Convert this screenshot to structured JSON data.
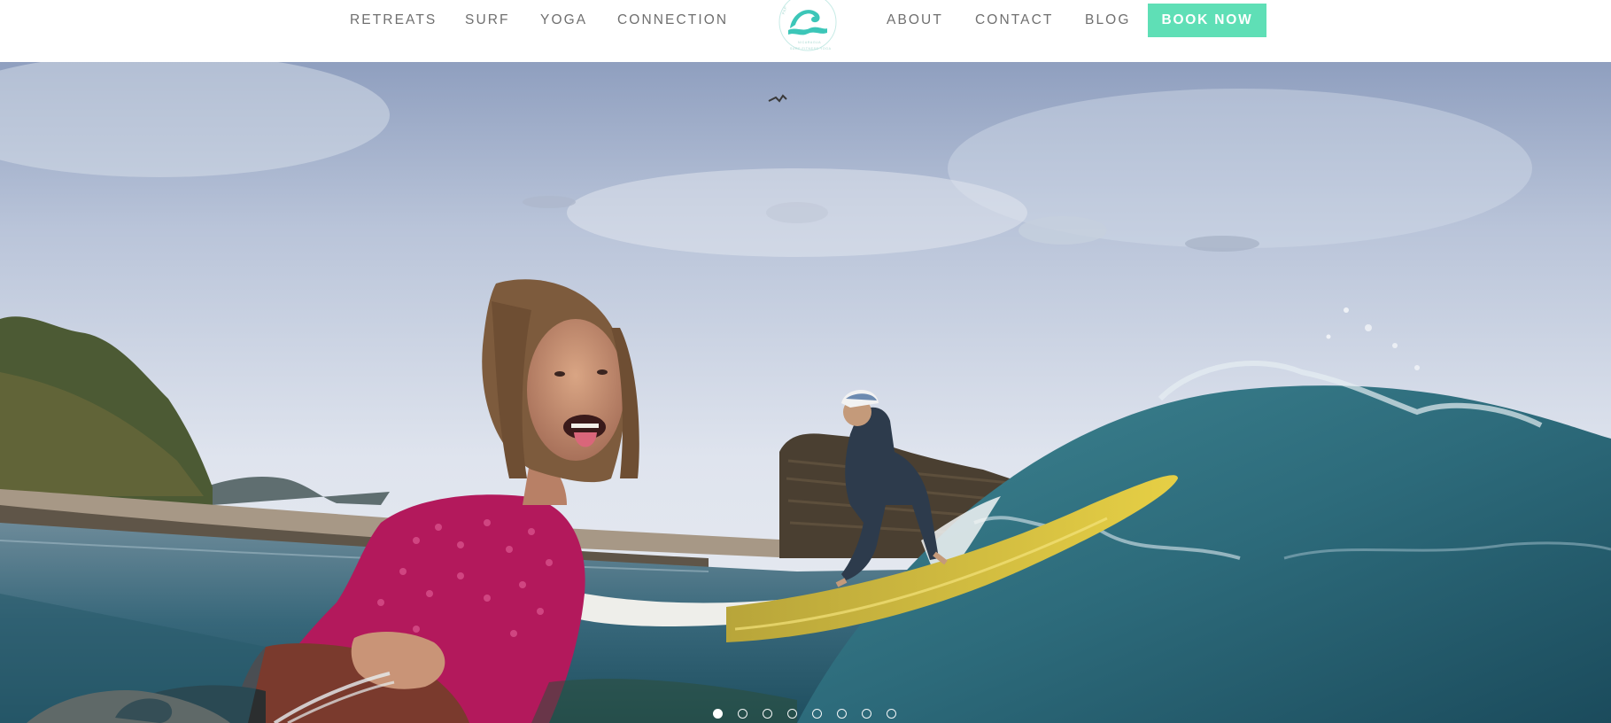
{
  "nav": {
    "left_items": [
      {
        "label": "RETREATS"
      },
      {
        "label": "SURF"
      },
      {
        "label": "YOGA"
      },
      {
        "label": "CONNECTION"
      }
    ],
    "right_items": [
      {
        "label": "ABOUT"
      },
      {
        "label": "CONTACT"
      },
      {
        "label": "BLOG"
      }
    ],
    "book_label": "BOOK NOW"
  },
  "logo": {
    "icon": "wave-logo-icon",
    "top_text": "PAP",
    "middle_text": "NICARAGUA",
    "bottom_text": "SURF FITNESS YOGA"
  },
  "hero": {
    "image": "surfers-wave-hero-photo"
  },
  "slider": {
    "total_slides": 8,
    "active_slide": 1
  },
  "colors": {
    "accent": "#5fdfb6",
    "nav_text": "#6f6f6f",
    "logo_teal": "#3cc6b8"
  }
}
